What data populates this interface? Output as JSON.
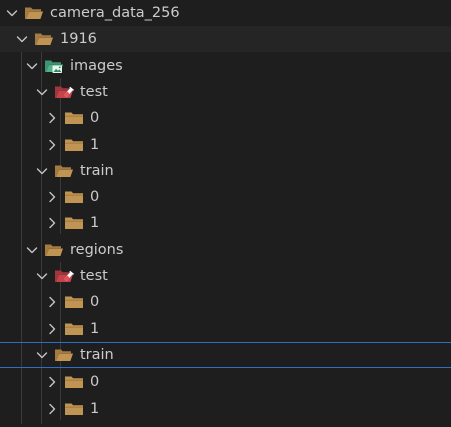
{
  "tree": {
    "root": {
      "label": "camera_data_256",
      "expanded": true,
      "icon": "folder-open-icon"
    },
    "n1916": {
      "label": "1916",
      "expanded": true,
      "icon": "folder-open-icon"
    },
    "images": {
      "label": "images",
      "expanded": true,
      "icon": "folder-images-open-icon",
      "test": {
        "label": "test",
        "expanded": true,
        "icon": "folder-test-open-icon",
        "items": [
          {
            "label": "0"
          },
          {
            "label": "1"
          }
        ]
      },
      "train": {
        "label": "train",
        "expanded": true,
        "icon": "folder-open-icon",
        "items": [
          {
            "label": "0"
          },
          {
            "label": "1"
          }
        ]
      }
    },
    "regions": {
      "label": "regions",
      "expanded": true,
      "icon": "folder-open-icon",
      "test": {
        "label": "test",
        "expanded": true,
        "icon": "folder-test-open-icon",
        "items": [
          {
            "label": "0"
          },
          {
            "label": "1"
          }
        ]
      },
      "train": {
        "label": "train",
        "expanded": true,
        "icon": "folder-open-icon",
        "selected": true,
        "items": [
          {
            "label": "0"
          },
          {
            "label": "1"
          }
        ]
      }
    }
  },
  "colors": {
    "background": "#1e1e1e",
    "text": "#cccccc",
    "folder": "#c09553",
    "images_folder": "#4fb38a",
    "test_folder": "#c5434b",
    "selection_border": "#2d6fc7"
  }
}
